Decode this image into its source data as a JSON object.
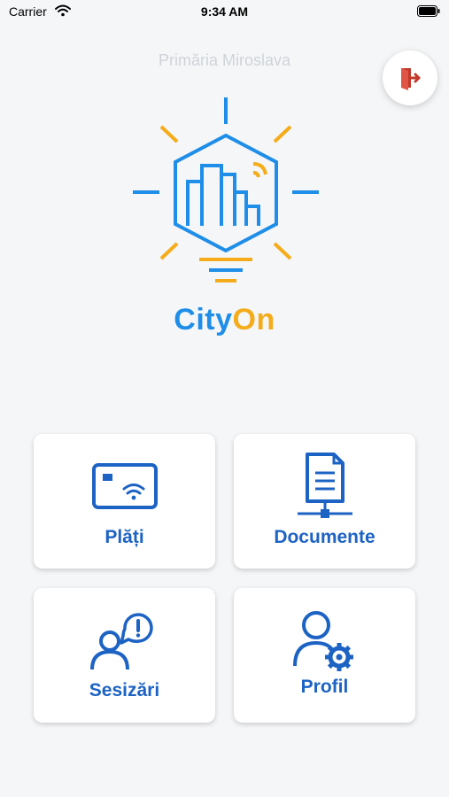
{
  "status_bar": {
    "carrier": "Carrier",
    "time": "9:34 AM"
  },
  "header": {
    "municipality": "Primăria Miroslava"
  },
  "brand": {
    "part1": "City",
    "part2": "On"
  },
  "tiles": [
    {
      "label": "Plăți",
      "icon": "card-payment-icon"
    },
    {
      "label": "Documente",
      "icon": "document-network-icon"
    },
    {
      "label": "Sesizări",
      "icon": "user-report-icon"
    },
    {
      "label": "Profil",
      "icon": "user-settings-icon"
    }
  ],
  "colors": {
    "background": "#f5f6f8",
    "primary_blue": "#1d63c4",
    "brand_blue": "#1e8ee8",
    "brand_yellow": "#f5ac1a",
    "logout_red": "#c0392b"
  }
}
